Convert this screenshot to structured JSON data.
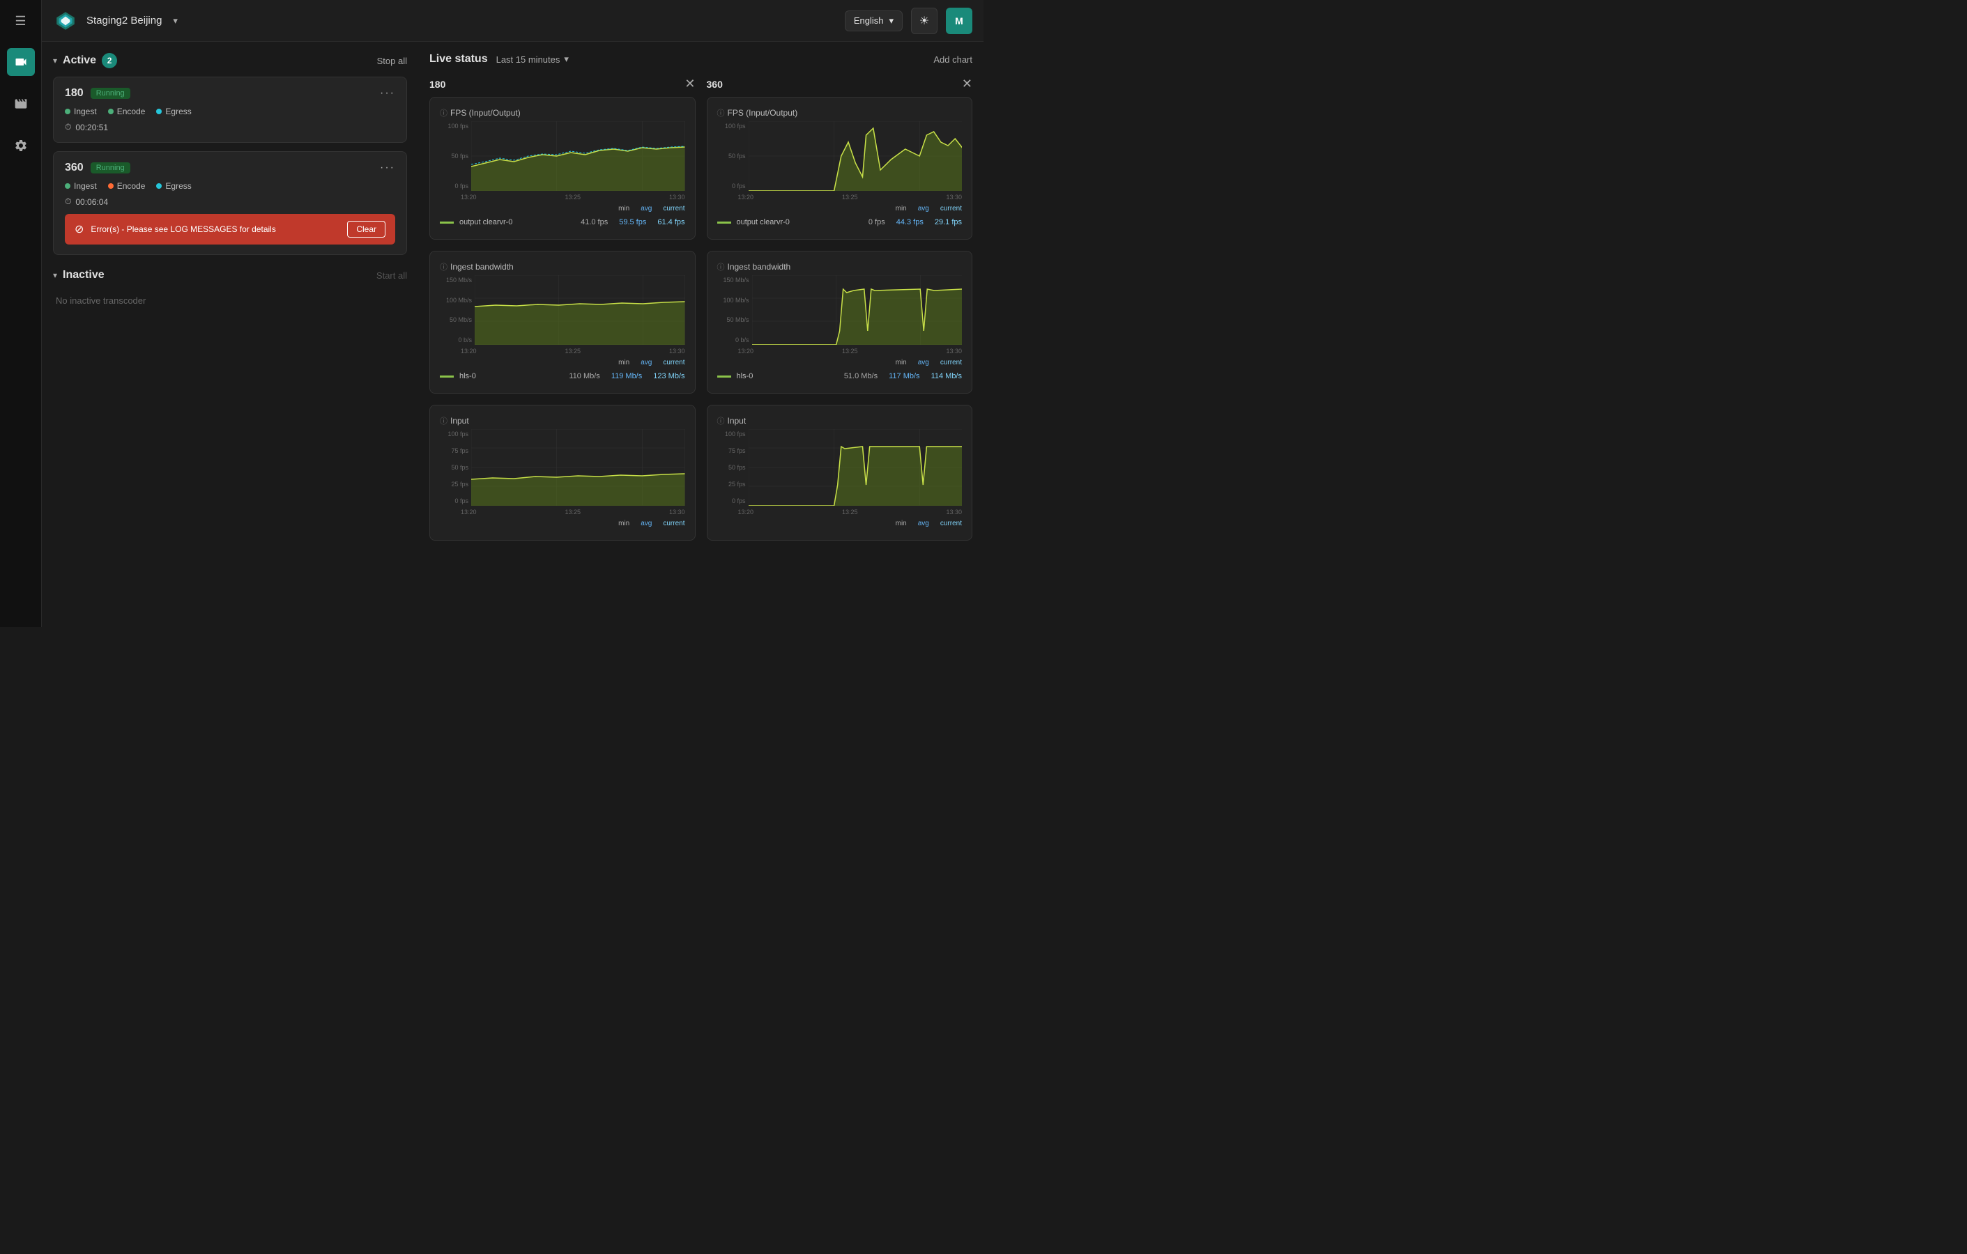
{
  "header": {
    "workspace": "Staging2 Beijing",
    "lang": "English",
    "user_initial": "M"
  },
  "sidebar": {
    "icons": [
      "hamburger",
      "video",
      "film",
      "settings"
    ]
  },
  "active_section": {
    "title": "Active",
    "badge": "2",
    "stop_all_label": "Stop all"
  },
  "transcoders": [
    {
      "id": "180",
      "status": "Running",
      "indicators": [
        "Ingest",
        "Encode",
        "Egress"
      ],
      "indicator_colors": [
        "green",
        "green",
        "teal"
      ],
      "timer": "00:20:51"
    },
    {
      "id": "360",
      "status": "Running",
      "indicators": [
        "Ingest",
        "Encode",
        "Egress"
      ],
      "indicator_colors": [
        "green",
        "orange",
        "teal"
      ],
      "timer": "00:06:04",
      "error": "Error(s) - Please see LOG MESSAGES for details",
      "clear_label": "Clear"
    }
  ],
  "inactive_section": {
    "title": "Inactive",
    "start_all_label": "Start all",
    "empty_text": "No inactive transcoder"
  },
  "live_status": {
    "title": "Live status",
    "time_range": "Last 15 minutes",
    "add_chart_label": "Add chart",
    "charts": [
      {
        "id": "180",
        "panels": [
          {
            "title": "FPS (Input/Output)",
            "y_labels": [
              "100 fps",
              "50 fps",
              "0 fps"
            ],
            "x_labels": [
              "13:20",
              "13:25",
              "13:30"
            ],
            "legend_label": "output clearvr-0",
            "legend_color": "#8bc34a",
            "stats": {
              "min": "41.0 fps",
              "avg": "59.5 fps",
              "current": "61.4 fps"
            }
          },
          {
            "title": "Ingest bandwidth",
            "y_labels": [
              "150 Mb/s",
              "100 Mb/s",
              "50 Mb/s",
              "0 b/s"
            ],
            "x_labels": [
              "13:20",
              "13:25",
              "13:30"
            ],
            "legend_label": "hls-0",
            "legend_color": "#8bc34a",
            "stats": {
              "min": "110 Mb/s",
              "avg": "119 Mb/s",
              "current": "123 Mb/s"
            }
          },
          {
            "title": "Input",
            "y_labels": [
              "100 fps",
              "75 fps",
              "50 fps",
              "25 fps",
              "0 fps"
            ],
            "x_labels": [
              "13:20",
              "13:25",
              "13:30"
            ],
            "legend_label": "",
            "legend_color": "#8bc34a",
            "stats": {
              "min": "min",
              "avg": "avg",
              "current": "current"
            }
          }
        ]
      },
      {
        "id": "360",
        "panels": [
          {
            "title": "FPS (Input/Output)",
            "y_labels": [
              "100 fps",
              "50 fps",
              "0 fps"
            ],
            "x_labels": [
              "13:20",
              "13:25",
              "13:30"
            ],
            "legend_label": "output clearvr-0",
            "legend_color": "#8bc34a",
            "stats": {
              "min": "0 fps",
              "avg": "44.3 fps",
              "current": "29.1 fps"
            }
          },
          {
            "title": "Ingest bandwidth",
            "y_labels": [
              "150 Mb/s",
              "100 Mb/s",
              "50 Mb/s",
              "0 b/s"
            ],
            "x_labels": [
              "13:20",
              "13:25",
              "13:30"
            ],
            "legend_label": "hls-0",
            "legend_color": "#8bc34a",
            "stats": {
              "min": "51.0 Mb/s",
              "avg": "117 Mb/s",
              "current": "114 Mb/s"
            }
          },
          {
            "title": "Input",
            "y_labels": [
              "100 fps",
              "75 fps",
              "50 fps",
              "25 fps",
              "0 fps"
            ],
            "x_labels": [
              "13:20",
              "13:25",
              "13:30"
            ],
            "legend_label": "",
            "legend_color": "#8bc34a",
            "stats": {
              "min": "min",
              "avg": "avg",
              "current": "current"
            }
          }
        ]
      }
    ]
  }
}
